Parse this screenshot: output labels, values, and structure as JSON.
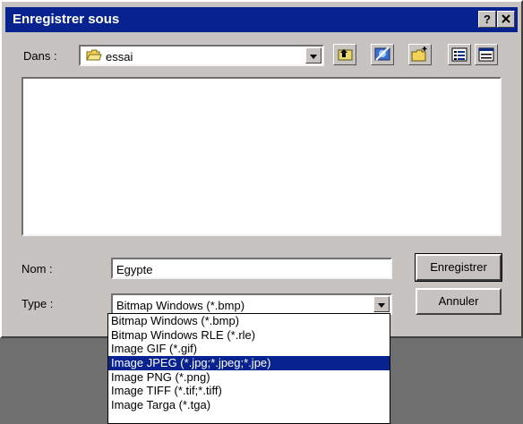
{
  "window": {
    "title": "Enregistrer sous",
    "help_label": "?",
    "close_label": "X"
  },
  "location": {
    "label": "Dans :",
    "folder": "essai",
    "toolbar_icons": [
      "up-one-level-icon",
      "desktop-icon",
      "new-folder-icon",
      "list-view-icon",
      "details-view-icon"
    ]
  },
  "filename": {
    "label": "Nom :",
    "value": "Egypte"
  },
  "filetype": {
    "label": "Type :",
    "value": "Bitmap Windows (*.bmp)",
    "options": [
      "Bitmap Windows (*.bmp)",
      "Bitmap Windows RLE (*.rle)",
      "Image GIF (*.gif)",
      "Image JPEG (*.jpg;*.jpeg;*.jpe)",
      "Image PNG (*.png)",
      "Image TIFF (*.tif;*.tiff)",
      "Image Targa (*.tga)"
    ],
    "selected_option": "Image JPEG (*.jpg;*.jpeg;*.jpe)"
  },
  "buttons": {
    "save": "Enregistrer",
    "cancel": "Annuler"
  },
  "colors": {
    "titlebar": "#08238f",
    "dialog_bg": "#c7c3c0",
    "selection": "#08238f",
    "desktop": "#6f6f6f"
  }
}
